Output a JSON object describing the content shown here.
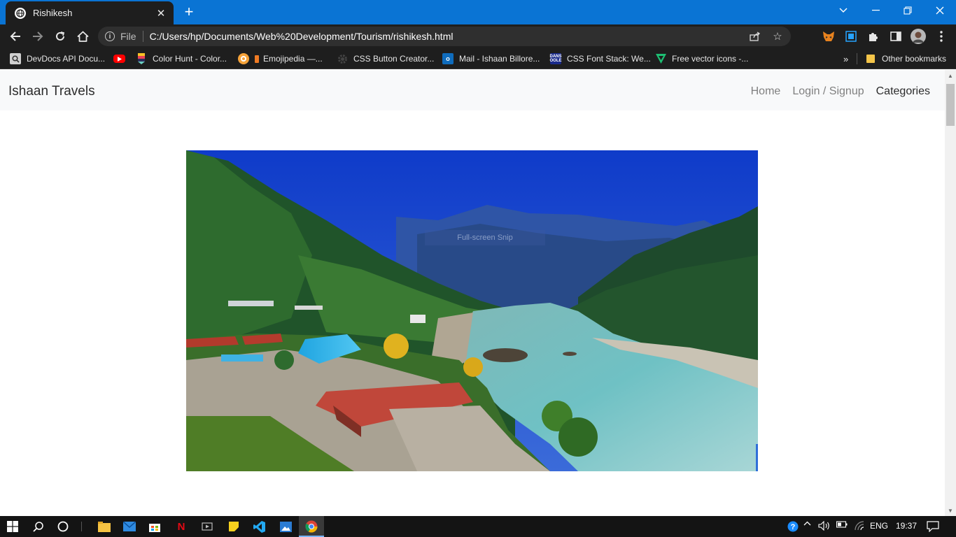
{
  "browser": {
    "tab": {
      "title": "Rishikesh",
      "favicon": "globe-icon"
    },
    "address": {
      "scheme_label": "File",
      "url": "C:/Users/hp/Documents/Web%20Development/Tourism/rishikesh.html"
    },
    "bookmarks": [
      {
        "label": "DevDocs API Docu...",
        "icon": "devdocs-icon"
      },
      {
        "label": "",
        "icon": "youtube-icon"
      },
      {
        "label": "Color Hunt - Color...",
        "icon": "colorhunt-icon"
      },
      {
        "label": "Emojipedia —...",
        "icon": "emojipedia-icon"
      },
      {
        "label": "CSS Button Creator...",
        "icon": "gear-icon"
      },
      {
        "label": "Mail - Ishaan Billore...",
        "icon": "outlook-icon"
      },
      {
        "label": "CSS Font Stack: We...",
        "icon": "cssfontstack-icon"
      },
      {
        "label": "Free vector icons -...",
        "icon": "flaticon-icon"
      }
    ],
    "more_bookmarks_label": "»",
    "other_bookmarks": "Other bookmarks"
  },
  "page": {
    "brand": "Ishaan Travels",
    "nav": [
      {
        "label": "Home",
        "active": false
      },
      {
        "label": "Login / Signup",
        "active": false
      },
      {
        "label": "Categories",
        "active": true
      }
    ],
    "hero_alt": "Rishikesh",
    "snip_overlay": "Full-screen Snip"
  },
  "taskbar": {
    "language": "ENG",
    "time": "19:37"
  },
  "colors": {
    "tabstrip": "#0a74d4",
    "toolbar": "#1e1e1e",
    "navbar_bg": "#f8f9fa"
  }
}
